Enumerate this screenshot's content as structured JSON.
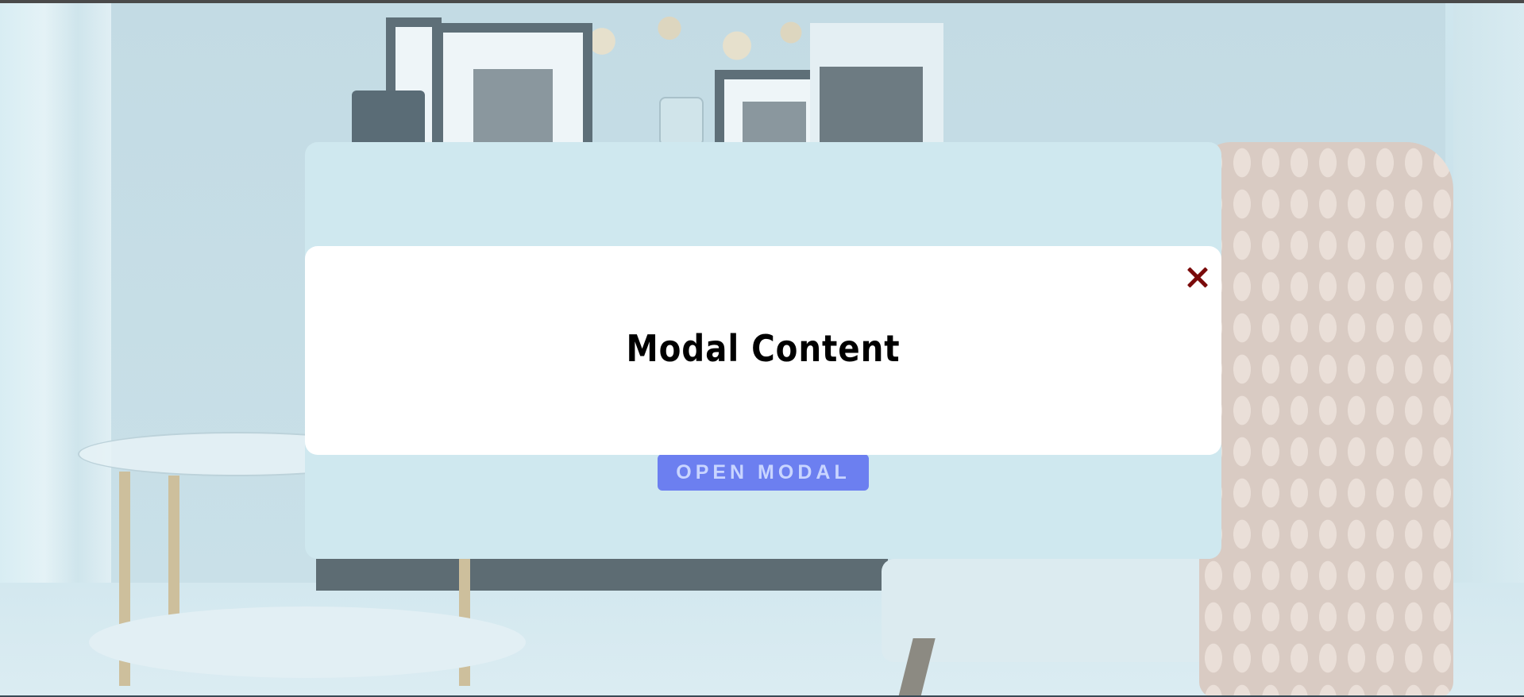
{
  "page": {
    "background_scene": "living room interior photo (blurred, tinted)"
  },
  "modal": {
    "title": "Modal Content",
    "close_icon": "close-icon",
    "close_color": "#7a0a0a"
  },
  "open_button": {
    "label": "OPEN MODAL",
    "color": "#6c7ff0"
  }
}
